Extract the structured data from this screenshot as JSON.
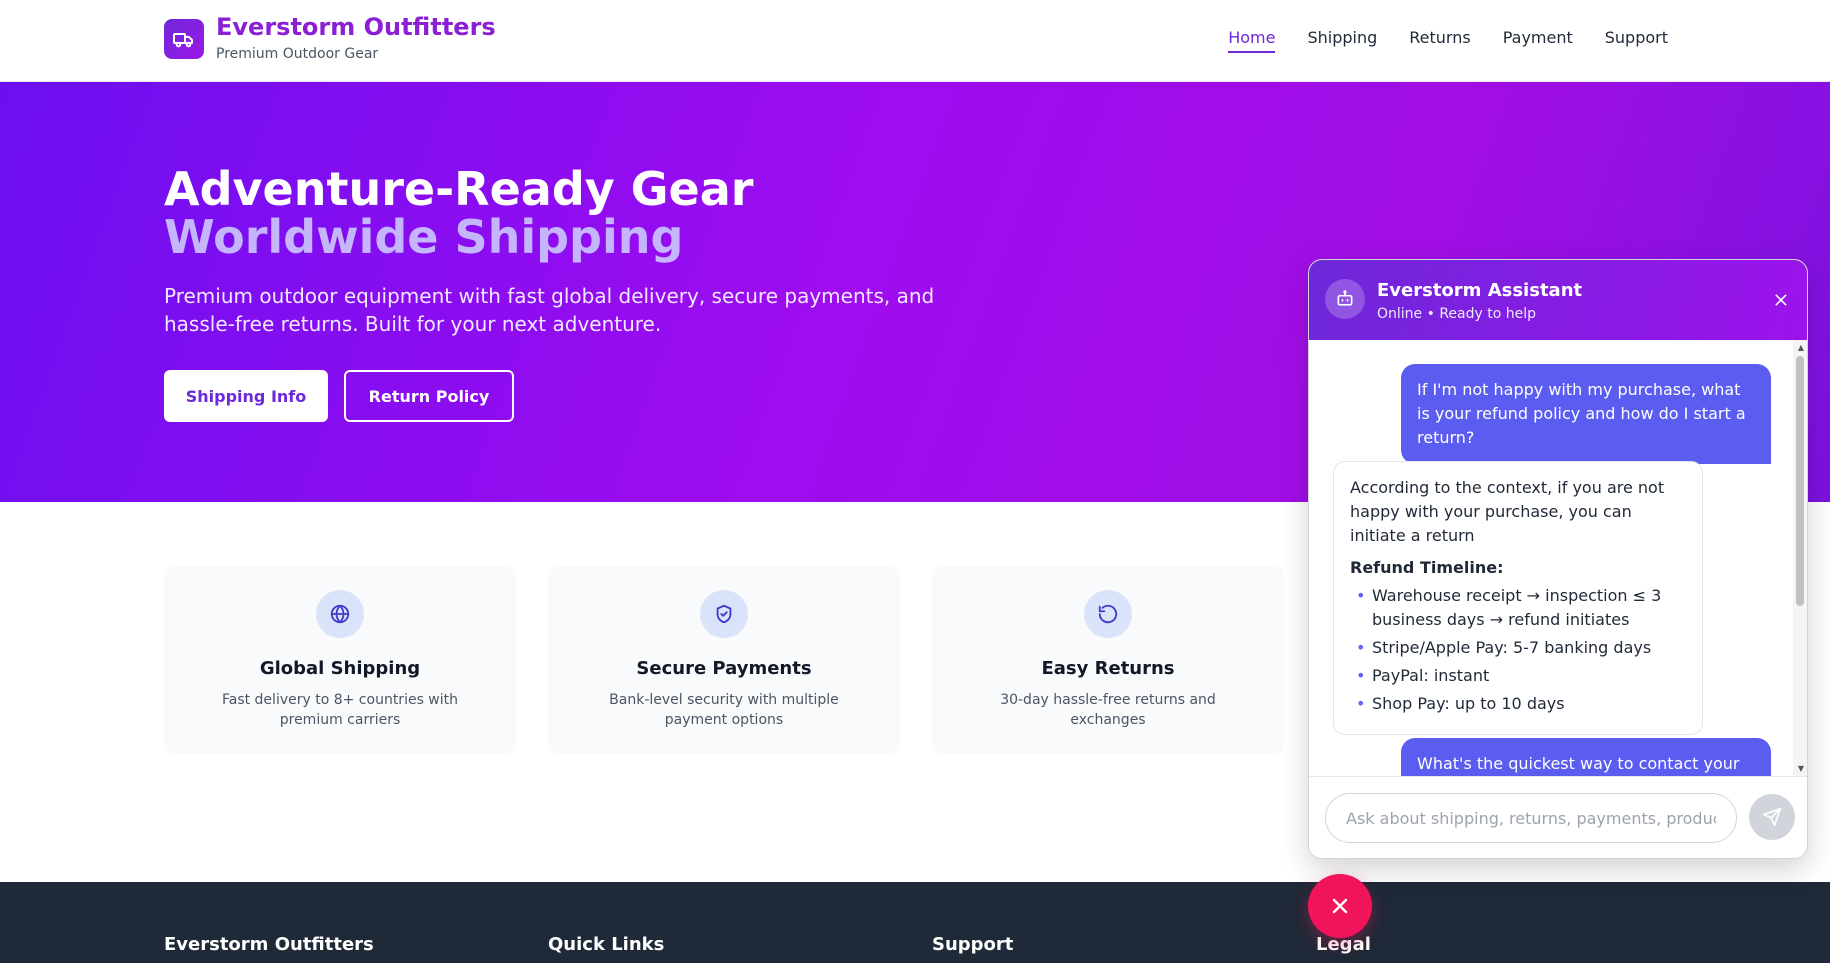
{
  "brand": {
    "name": "Everstorm Outfitters",
    "tagline": "Premium Outdoor Gear",
    "icon": "truck-icon",
    "accent": "#8b1fd6"
  },
  "nav": {
    "items": [
      {
        "label": "Home",
        "active": true
      },
      {
        "label": "Shipping",
        "active": false
      },
      {
        "label": "Returns",
        "active": false
      },
      {
        "label": "Payment",
        "active": false
      },
      {
        "label": "Support",
        "active": false
      }
    ]
  },
  "hero": {
    "title_line1": "Adventure-Ready Gear",
    "title_line2": "Worldwide Shipping",
    "subtitle": "Premium outdoor equipment with fast global delivery, secure payments, and hassle-free returns. Built for your next adventure.",
    "primary_button": "Shipping Info",
    "secondary_button": "Return Policy"
  },
  "features": [
    {
      "icon": "globe-icon",
      "title": "Global Shipping",
      "desc": "Fast delivery to 8+ countries with premium carriers"
    },
    {
      "icon": "shield-check-icon",
      "title": "Secure Payments",
      "desc": "Bank-level security with multiple payment options"
    },
    {
      "icon": "rotate-ccw-icon",
      "title": "Easy Returns",
      "desc": "30-day hassle-free returns and exchanges"
    }
  ],
  "footer": {
    "columns": [
      "Everstorm Outfitters",
      "Quick Links",
      "Support",
      "Legal"
    ]
  },
  "chat": {
    "title": "Everstorm Assistant",
    "status": "Online • Ready to help",
    "messages": {
      "user1": "If I'm not happy with my purchase, what is your refund policy and how do I start a return?",
      "bot1_intro": "According to the context, if you are not happy with your purchase, you can initiate a return",
      "bot1_heading": "Refund Timeline:",
      "bot1_items": [
        "Warehouse receipt → inspection ≤ 3 business days → refund initiates",
        "Stripe/Apple Pay: 5-7 banking days",
        "PayPal: instant",
        "Shop Pay: up to 10 days"
      ],
      "user2": "What's the quickest way to contact your"
    },
    "input_placeholder": "Ask about shipping, returns, payments, product info..."
  }
}
